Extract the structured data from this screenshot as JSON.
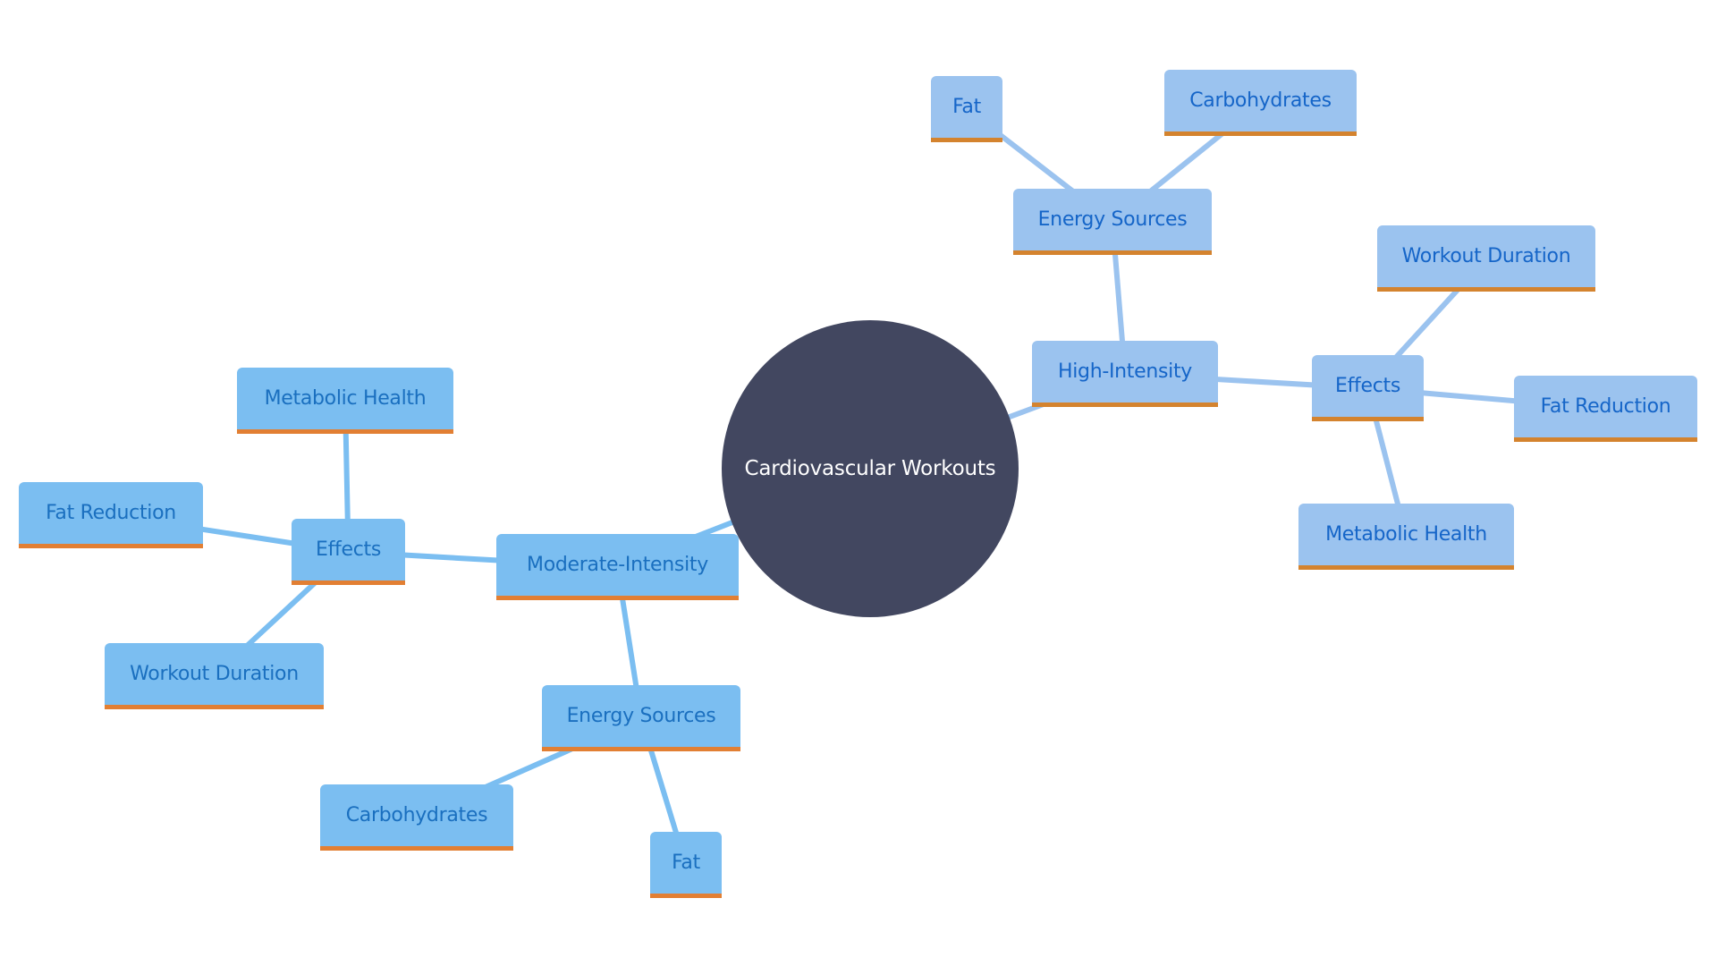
{
  "diagram": {
    "type": "mindmap",
    "root": {
      "id": "root",
      "label": "Cardiovascular Workouts"
    },
    "colors": {
      "root_fill": "#424760",
      "root_text": "#ffffff",
      "high_intensity_fill": "#9bc3ef",
      "high_intensity_text": "#1565c8",
      "high_intensity_edge": "#9bc3ef",
      "moderate_intensity_fill": "#7bbef1",
      "moderate_intensity_text": "#1a6fbf",
      "moderate_intensity_edge": "#7bbef1",
      "accent_underline": "#d4832e"
    },
    "nodes": [
      {
        "id": "hi",
        "label": "High-Intensity",
        "parent": "root",
        "branch": "hi"
      },
      {
        "id": "hi-energy",
        "label": "Energy Sources",
        "parent": "hi",
        "branch": "hi"
      },
      {
        "id": "hi-energy-fat",
        "label": "Fat",
        "parent": "hi-energy",
        "branch": "hi"
      },
      {
        "id": "hi-energy-carbs",
        "label": "Carbohydrates",
        "parent": "hi-energy",
        "branch": "hi"
      },
      {
        "id": "hi-effects",
        "label": "Effects",
        "parent": "hi",
        "branch": "hi"
      },
      {
        "id": "hi-effects-duration",
        "label": "Workout Duration",
        "parent": "hi-effects",
        "branch": "hi"
      },
      {
        "id": "hi-effects-fat",
        "label": "Fat Reduction",
        "parent": "hi-effects",
        "branch": "hi"
      },
      {
        "id": "hi-effects-metabolic",
        "label": "Metabolic Health",
        "parent": "hi-effects",
        "branch": "hi"
      },
      {
        "id": "mi",
        "label": "Moderate-Intensity",
        "parent": "root",
        "branch": "mi"
      },
      {
        "id": "mi-effects",
        "label": "Effects",
        "parent": "mi",
        "branch": "mi"
      },
      {
        "id": "mi-effects-metabolic",
        "label": "Metabolic Health",
        "parent": "mi-effects",
        "branch": "mi"
      },
      {
        "id": "mi-effects-fat",
        "label": "Fat Reduction",
        "parent": "mi-effects",
        "branch": "mi"
      },
      {
        "id": "mi-effects-duration",
        "label": "Workout Duration",
        "parent": "mi-effects",
        "branch": "mi"
      },
      {
        "id": "mi-energy",
        "label": "Energy Sources",
        "parent": "mi",
        "branch": "mi"
      },
      {
        "id": "mi-energy-carbs",
        "label": "Carbohydrates",
        "parent": "mi-energy",
        "branch": "mi"
      },
      {
        "id": "mi-energy-fat",
        "label": "Fat",
        "parent": "mi-energy",
        "branch": "mi"
      }
    ]
  }
}
